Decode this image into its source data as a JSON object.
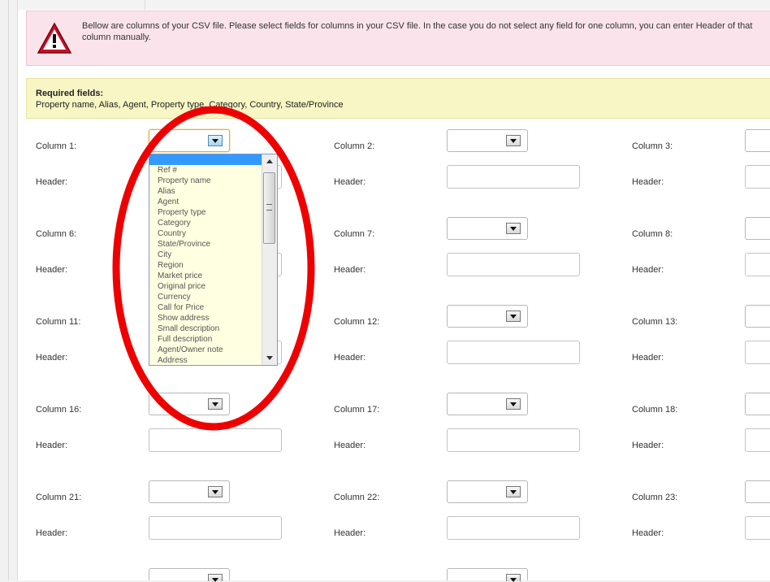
{
  "notice": {
    "text": "Bellow are columns of your CSV file. Please select fields for columns in your CSV file. In the case you do not select any field for one column, you can enter Header of that column manually."
  },
  "required": {
    "title": "Required fields:",
    "fields": "Property name, Alias, Agent, Property type, Category, Country, State/Province"
  },
  "header_label": "Header:",
  "columns": {
    "c1": "Column 1:",
    "c2": "Column 2:",
    "c3": "Column 3:",
    "c6": "Column 6:",
    "c7": "Column 7:",
    "c8": "Column 8:",
    "c11": "Column 11:",
    "c12": "Column 12:",
    "c13": "Column 13:",
    "c16": "Column 16:",
    "c17": "Column 17:",
    "c18": "Column 18:",
    "c21": "Column 21:",
    "c22": "Column 22:",
    "c23": "Column 23:"
  },
  "dropdown": {
    "selected": "",
    "options": [
      "Ref #",
      "Property name",
      "Alias",
      "Agent",
      "Property type",
      "Category",
      "Country",
      "State/Province",
      "City",
      "Region",
      "Market price",
      "Original price",
      "Currency",
      "Call for Price",
      "Show address",
      "Small description",
      "Full description",
      "Agent/Owner note",
      "Address"
    ]
  },
  "colors": {
    "notice_bg": "#fbe3ec",
    "required_bg": "#f8f6c4",
    "dropdown_bg": "#ffffe1",
    "highlight": "#3399ff",
    "annotation_circle": "#ee0000"
  },
  "icons": {
    "warning": "warning-triangle-icon"
  }
}
